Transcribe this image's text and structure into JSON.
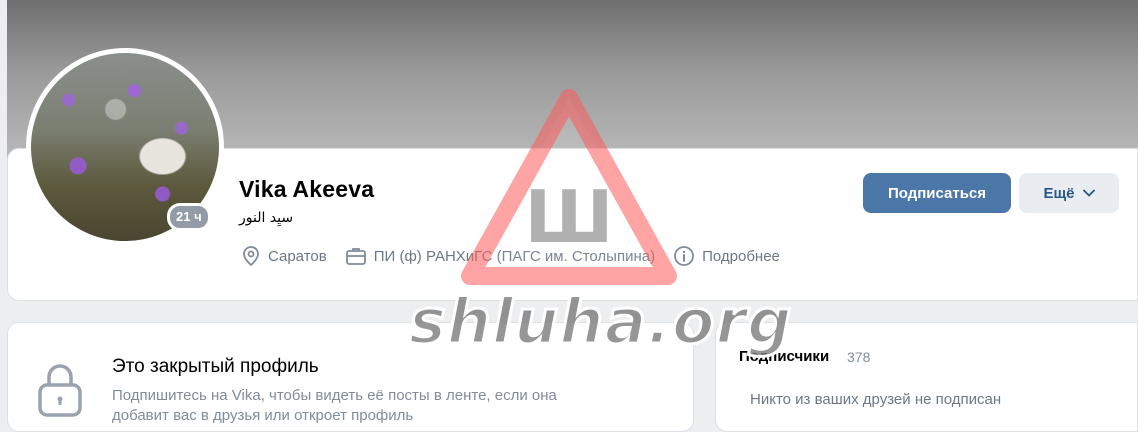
{
  "profile": {
    "name": "Vika Akeeva",
    "status": "سيِد النور",
    "last_seen_badge": "21 ч",
    "info": [
      {
        "icon": "location-pin-icon",
        "text": "Саратов"
      },
      {
        "icon": "briefcase-icon",
        "text": "ПИ (ф) РАНХиГС (ПАГС им. Столыпина)"
      },
      {
        "icon": "info-circle-icon",
        "text": "Подробнее"
      }
    ]
  },
  "actions": {
    "subscribe_label": "Подписаться",
    "more_label": "Ещё"
  },
  "closed_profile": {
    "title": "Это закрытый профиль",
    "description": "Подпишитесь на Vika, чтобы видеть её посты в ленте, если она добавит вас в друзья или откроет профиль"
  },
  "followers": {
    "title": "Подписчики",
    "count": "378",
    "empty_text": "Никто из ваших друзей не подписан"
  },
  "watermark": {
    "letter": "Ш",
    "text": "shluha.org"
  },
  "colors": {
    "primary_button": "#4a76a8",
    "secondary_button": "#e9ecf0",
    "muted_text": "#818c99",
    "watermark_red": "#ff5a5a"
  }
}
